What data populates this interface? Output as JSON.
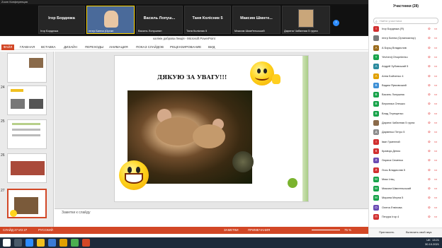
{
  "window": {
    "title": "Zoom Конференция"
  },
  "video_strip": {
    "tiles": [
      {
        "big": "Ігор Бордюжа",
        "small": "Ігор Бордюжа"
      },
      {
        "big": "",
        "small": "mnrp Бинна (Орган"
      },
      {
        "big": "Василь Лопуш...",
        "small": "Василь Лопушнян"
      },
      {
        "big": "Таня Колісник 5",
        "small": "Таня Колісник 5"
      },
      {
        "big": "Максим Шмнте...",
        "small": "Максим Шмиґельський"
      },
      {
        "big": "",
        "small": "Дарина Чабанная 5 група"
      }
    ]
  },
  "ppt": {
    "title": "калінін доброва Лекція - Microsoft PowerPoint",
    "tabs": [
      "ФАЙЛ",
      "ГЛАВНАЯ",
      "ВСТАВКА",
      "ДИЗАЙН",
      "ПЕРЕХОДЫ",
      "АНИМАЦИЯ",
      "ПОКАЗ СЛАЙДОВ",
      "РЕЦЕНЗИРОВАНИЕ",
      "ВИД"
    ],
    "thumbs": [
      {
        "num": ""
      },
      {
        "num": "24"
      },
      {
        "num": "25"
      },
      {
        "num": "26"
      },
      {
        "num": "27"
      }
    ],
    "slide": {
      "title": "ДЯКУЮ ЗА УВАГУ!!!",
      "credit": ""
    },
    "notes_placeholder": "Заметки к слайду",
    "status": {
      "slide": "СЛАЙД 27 ИЗ 27",
      "lang": "РУССКИЙ",
      "notes": "ЗАМЕТКИ",
      "comments": "ПРИМЕЧАНИЯ",
      "zoom": "75 %"
    }
  },
  "panel": {
    "header": "Участники (28)",
    "search_placeholder": "Найти участника",
    "participants": [
      {
        "name": "Ігор Бордюжа (Я)",
        "initial": "I",
        "color": "#d12f2f"
      },
      {
        "name": "mnrp Бинна (Организатор)",
        "initial": "",
        "color": "#7a7a7a"
      },
      {
        "name": "А Борщ Владислав",
        "initial": "А",
        "color": "#9a6a1a"
      },
      {
        "name": "Yevhenij Ohopriienko",
        "initial": "Y",
        "color": "#17a34a"
      },
      {
        "name": "Андрій Зубовський 5",
        "initial": "А",
        "color": "#2b8a9e"
      },
      {
        "name": "Анна Бойченко 4",
        "initial": "А",
        "color": "#e0a000"
      },
      {
        "name": "Вадим Ярмовський",
        "initial": "В",
        "color": "#3d8fd6"
      },
      {
        "name": "Василь Лопушняк",
        "initial": "В",
        "color": "#17a34a"
      },
      {
        "name": "Вероника Онешко",
        "initial": "В",
        "color": "#17a34a"
      },
      {
        "name": "Влад Терещенко",
        "initial": "В",
        "color": "#17a34a"
      },
      {
        "name": "Дарина Чабанная 5 група",
        "initial": "",
        "color": "#8a6a4a"
      },
      {
        "name": "Дарвенко Петро 5",
        "initial": "Д",
        "color": "#8a8a8a"
      },
      {
        "name": "Іван Гуменний",
        "initial": "І",
        "color": "#d12f2f"
      },
      {
        "name": "Кравчук Денис",
        "initial": "К",
        "color": "#d12f2f"
      },
      {
        "name": "Лариса Семенко",
        "initial": "Л",
        "color": "#6a4ab3"
      },
      {
        "name": "Лось Владислав 5",
        "initial": "Л",
        "color": "#d12f2f"
      },
      {
        "name": "Макс Іліщ",
        "initial": "М",
        "color": "#17a34a"
      },
      {
        "name": "Максим Шмигельський",
        "initial": "М",
        "color": "#17a34a"
      },
      {
        "name": "Марина Мерна 5",
        "initial": "М",
        "color": "#17a34a"
      },
      {
        "name": "Олена Лтвінова",
        "initial": "О",
        "color": "#6a4ab3"
      },
      {
        "name": "Печура Ігор 4",
        "initial": "П",
        "color": "#d12f2f"
      }
    ],
    "footer": {
      "invite": "Пригласить",
      "unmute_all": "Включить свой звук"
    }
  },
  "taskbar": {
    "time": "13:21",
    "date": "30.10.2021",
    "lang": "UK"
  }
}
